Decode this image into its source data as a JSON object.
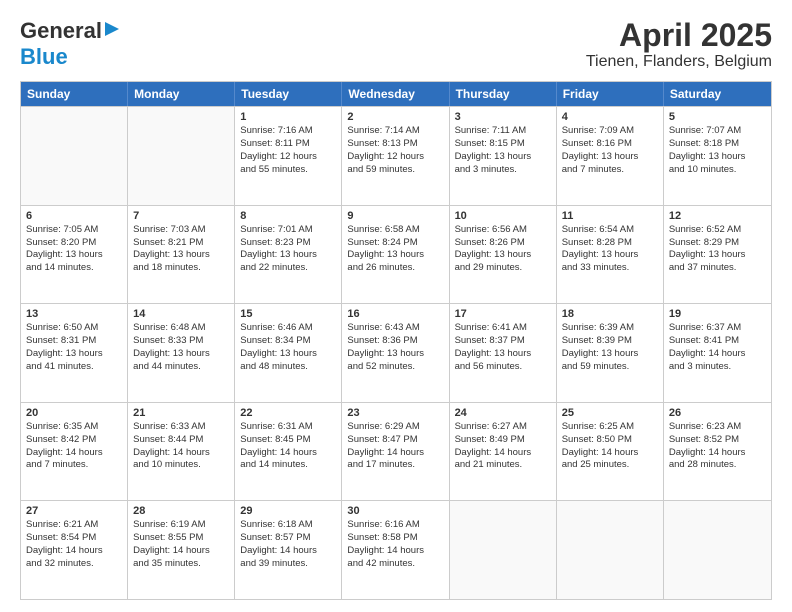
{
  "header": {
    "logo_general": "General",
    "logo_blue": "Blue",
    "title": "April 2025",
    "subtitle": "Tienen, Flanders, Belgium"
  },
  "days": [
    "Sunday",
    "Monday",
    "Tuesday",
    "Wednesday",
    "Thursday",
    "Friday",
    "Saturday"
  ],
  "rows": [
    [
      {
        "day": "",
        "info": ""
      },
      {
        "day": "",
        "info": ""
      },
      {
        "day": "1",
        "info": "Sunrise: 7:16 AM\nSunset: 8:11 PM\nDaylight: 12 hours\nand 55 minutes."
      },
      {
        "day": "2",
        "info": "Sunrise: 7:14 AM\nSunset: 8:13 PM\nDaylight: 12 hours\nand 59 minutes."
      },
      {
        "day": "3",
        "info": "Sunrise: 7:11 AM\nSunset: 8:15 PM\nDaylight: 13 hours\nand 3 minutes."
      },
      {
        "day": "4",
        "info": "Sunrise: 7:09 AM\nSunset: 8:16 PM\nDaylight: 13 hours\nand 7 minutes."
      },
      {
        "day": "5",
        "info": "Sunrise: 7:07 AM\nSunset: 8:18 PM\nDaylight: 13 hours\nand 10 minutes."
      }
    ],
    [
      {
        "day": "6",
        "info": "Sunrise: 7:05 AM\nSunset: 8:20 PM\nDaylight: 13 hours\nand 14 minutes."
      },
      {
        "day": "7",
        "info": "Sunrise: 7:03 AM\nSunset: 8:21 PM\nDaylight: 13 hours\nand 18 minutes."
      },
      {
        "day": "8",
        "info": "Sunrise: 7:01 AM\nSunset: 8:23 PM\nDaylight: 13 hours\nand 22 minutes."
      },
      {
        "day": "9",
        "info": "Sunrise: 6:58 AM\nSunset: 8:24 PM\nDaylight: 13 hours\nand 26 minutes."
      },
      {
        "day": "10",
        "info": "Sunrise: 6:56 AM\nSunset: 8:26 PM\nDaylight: 13 hours\nand 29 minutes."
      },
      {
        "day": "11",
        "info": "Sunrise: 6:54 AM\nSunset: 8:28 PM\nDaylight: 13 hours\nand 33 minutes."
      },
      {
        "day": "12",
        "info": "Sunrise: 6:52 AM\nSunset: 8:29 PM\nDaylight: 13 hours\nand 37 minutes."
      }
    ],
    [
      {
        "day": "13",
        "info": "Sunrise: 6:50 AM\nSunset: 8:31 PM\nDaylight: 13 hours\nand 41 minutes."
      },
      {
        "day": "14",
        "info": "Sunrise: 6:48 AM\nSunset: 8:33 PM\nDaylight: 13 hours\nand 44 minutes."
      },
      {
        "day": "15",
        "info": "Sunrise: 6:46 AM\nSunset: 8:34 PM\nDaylight: 13 hours\nand 48 minutes."
      },
      {
        "day": "16",
        "info": "Sunrise: 6:43 AM\nSunset: 8:36 PM\nDaylight: 13 hours\nand 52 minutes."
      },
      {
        "day": "17",
        "info": "Sunrise: 6:41 AM\nSunset: 8:37 PM\nDaylight: 13 hours\nand 56 minutes."
      },
      {
        "day": "18",
        "info": "Sunrise: 6:39 AM\nSunset: 8:39 PM\nDaylight: 13 hours\nand 59 minutes."
      },
      {
        "day": "19",
        "info": "Sunrise: 6:37 AM\nSunset: 8:41 PM\nDaylight: 14 hours\nand 3 minutes."
      }
    ],
    [
      {
        "day": "20",
        "info": "Sunrise: 6:35 AM\nSunset: 8:42 PM\nDaylight: 14 hours\nand 7 minutes."
      },
      {
        "day": "21",
        "info": "Sunrise: 6:33 AM\nSunset: 8:44 PM\nDaylight: 14 hours\nand 10 minutes."
      },
      {
        "day": "22",
        "info": "Sunrise: 6:31 AM\nSunset: 8:45 PM\nDaylight: 14 hours\nand 14 minutes."
      },
      {
        "day": "23",
        "info": "Sunrise: 6:29 AM\nSunset: 8:47 PM\nDaylight: 14 hours\nand 17 minutes."
      },
      {
        "day": "24",
        "info": "Sunrise: 6:27 AM\nSunset: 8:49 PM\nDaylight: 14 hours\nand 21 minutes."
      },
      {
        "day": "25",
        "info": "Sunrise: 6:25 AM\nSunset: 8:50 PM\nDaylight: 14 hours\nand 25 minutes."
      },
      {
        "day": "26",
        "info": "Sunrise: 6:23 AM\nSunset: 8:52 PM\nDaylight: 14 hours\nand 28 minutes."
      }
    ],
    [
      {
        "day": "27",
        "info": "Sunrise: 6:21 AM\nSunset: 8:54 PM\nDaylight: 14 hours\nand 32 minutes."
      },
      {
        "day": "28",
        "info": "Sunrise: 6:19 AM\nSunset: 8:55 PM\nDaylight: 14 hours\nand 35 minutes."
      },
      {
        "day": "29",
        "info": "Sunrise: 6:18 AM\nSunset: 8:57 PM\nDaylight: 14 hours\nand 39 minutes."
      },
      {
        "day": "30",
        "info": "Sunrise: 6:16 AM\nSunset: 8:58 PM\nDaylight: 14 hours\nand 42 minutes."
      },
      {
        "day": "",
        "info": ""
      },
      {
        "day": "",
        "info": ""
      },
      {
        "day": "",
        "info": ""
      }
    ]
  ]
}
